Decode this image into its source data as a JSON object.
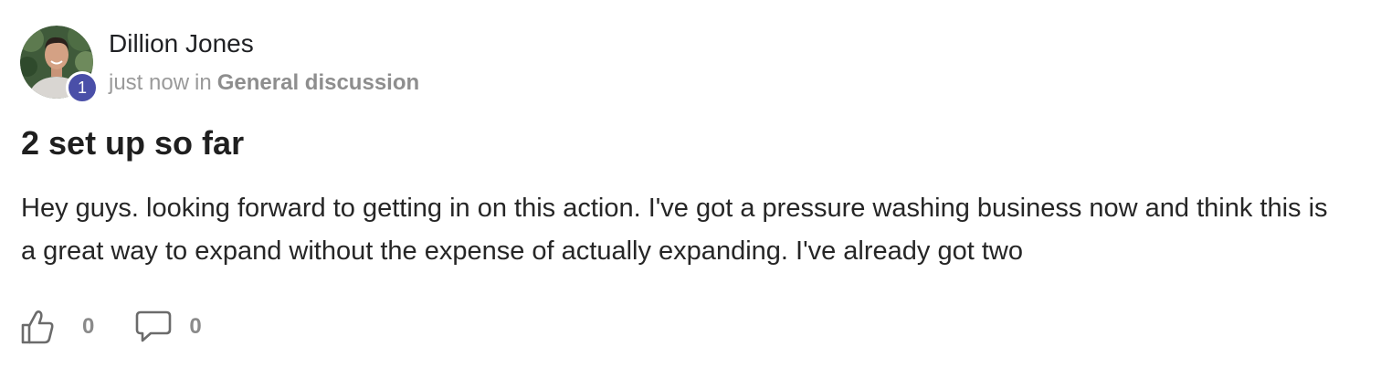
{
  "post": {
    "author": {
      "name": "Dillion Jones",
      "level": "1"
    },
    "meta": {
      "time": "just now",
      "connector": "in",
      "category": "General discussion"
    },
    "title": "2 set up so far",
    "body": "Hey guys. looking forward to getting in on this action. I've got a pressure washing business now and think this is a great way to expand without the expense of actually expanding. I've already got two",
    "actions": {
      "likes": "0",
      "comments": "0"
    }
  },
  "colors": {
    "level_badge": "#4a4fa8",
    "meta_text": "#9a9a9a",
    "icon": "#6b6b6b"
  },
  "icons": {
    "like": "thumbs-up-icon",
    "comment": "comment-bubble-icon"
  }
}
